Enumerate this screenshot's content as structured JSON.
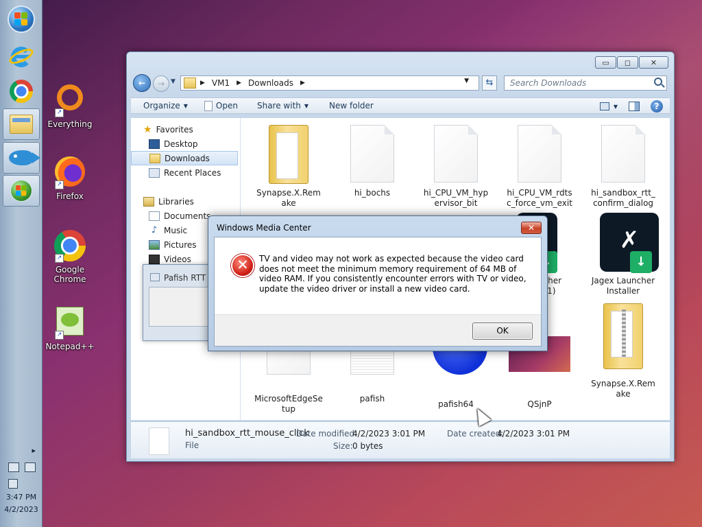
{
  "taskbar": {
    "items": [
      {
        "name": "start-button",
        "icon": "windows-orb-icon"
      },
      {
        "name": "internet-explorer",
        "icon": "internet-explorer-icon"
      },
      {
        "name": "chrome",
        "icon": "chrome-icon"
      },
      {
        "name": "windows-explorer",
        "icon": "folder-icon"
      },
      {
        "name": "pafish",
        "icon": "fish-icon"
      },
      {
        "name": "windows-media-center",
        "icon": "windows-flag-icon"
      }
    ],
    "clock_time": "3:47 PM",
    "clock_date": "4/2/2023",
    "tray_expand": "▸"
  },
  "desktop_icons": [
    {
      "label": "Everything",
      "icon": "everything-icon"
    },
    {
      "label": "Firefox",
      "icon": "firefox-icon"
    },
    {
      "label": "Google Chrome",
      "icon": "chrome-icon"
    },
    {
      "label": "Notepad++",
      "icon": "notepad-plus-plus-icon"
    }
  ],
  "explorer": {
    "caption_buttons": {
      "minimize": "▭",
      "maximize": "◻",
      "close": "✕"
    },
    "breadcrumb": [
      "VM1",
      "Downloads"
    ],
    "search_placeholder": "Search Downloads",
    "commands": {
      "organize": "Organize",
      "open": "Open",
      "share_with": "Share with",
      "new_folder": "New folder"
    },
    "nav": {
      "favorites": "Favorites",
      "desktop": "Desktop",
      "downloads": "Downloads",
      "recent_places": "Recent Places",
      "libraries": "Libraries",
      "documents": "Documents",
      "music": "Music",
      "pictures": "Pictures",
      "videos": "Videos"
    },
    "files": [
      "Synapse.X.Remake",
      "hi_bochs",
      "hi_CPU_VM_hypervisor_bit",
      "hi_CPU_VM_rdtsc_force_vm_exit",
      "hi_sandbox_rtt_confirm_dialog",
      "Jagex Launcher Installer",
      "MicrosoftEdgeSetup",
      "pafish",
      "pafish64",
      "QSjnP",
      "Synapse.X.Remake"
    ],
    "partial_labels": {
      "launcher_fragment": "ncher",
      "launcher_fragment_2": "(1)"
    },
    "details": {
      "name": "hi_sandbox_rtt_mouse_click",
      "type": "File",
      "modified_label": "Date modified:",
      "modified_value": "4/2/2023 3:01 PM",
      "created_label": "Date created:",
      "created_value": "4/2/2023 3:01 PM",
      "size_label": "Size:",
      "size_value": "0 bytes"
    }
  },
  "background_window": {
    "title": "Pafish RTT w"
  },
  "dialog": {
    "title": "Windows Media Center",
    "close": "✕",
    "icon": "error-icon",
    "message": "TV and video may not work as expected because the video card does not meet the minimum memory requirement of 64 MB of video RAM. If you consistently encounter errors with TV or video, update the video driver or install a new video card.",
    "ok_label": "OK"
  }
}
